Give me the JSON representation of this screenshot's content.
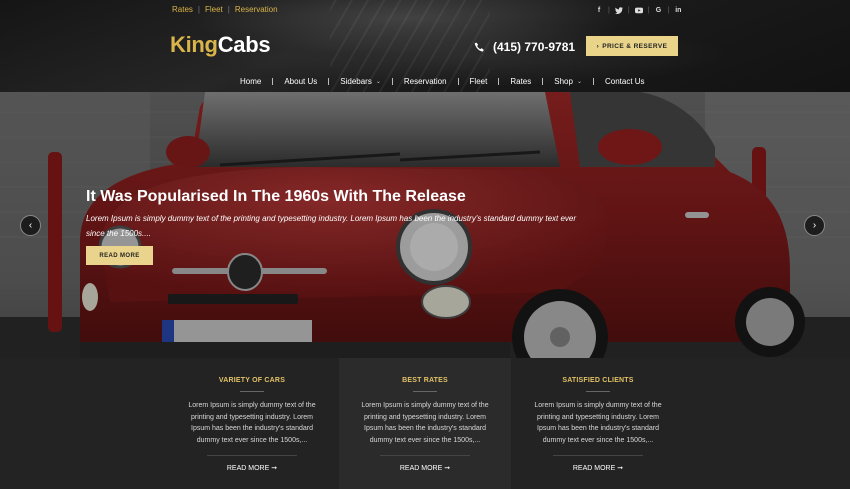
{
  "topbar": {
    "links": [
      "Rates",
      "Fleet",
      "Reservation"
    ],
    "social_icons": [
      "facebook-icon",
      "twitter-icon",
      "youtube-icon",
      "google-icon",
      "linkedin-icon"
    ]
  },
  "header": {
    "logo_part1": "King",
    "logo_part2": "Cabs",
    "phone": "(415) 770-9781",
    "cta_label": "PRICE & RESERVE"
  },
  "nav": {
    "items": [
      {
        "label": "Home",
        "dropdown": false
      },
      {
        "label": "About Us",
        "dropdown": false
      },
      {
        "label": "Sidebars",
        "dropdown": true
      },
      {
        "label": "Reservation",
        "dropdown": false
      },
      {
        "label": "Fleet",
        "dropdown": false
      },
      {
        "label": "Rates",
        "dropdown": false
      },
      {
        "label": "Shop",
        "dropdown": true
      },
      {
        "label": "Contact Us",
        "dropdown": false
      }
    ]
  },
  "hero": {
    "title": "It Was Popularised In The 1960s With The Release",
    "text": "Lorem Ipsum is simply dummy text of the printing and typesetting industry. Lorem Ipsum has been the industry's standard dummy text ever since the 1500s....",
    "button": "READ MORE"
  },
  "features": [
    {
      "title": "VARIETY OF CARS",
      "text": "Lorem Ipsum is simply dummy text of the printing and typesetting industry. Lorem Ipsum has been the industry's standard dummy text ever since the 1500s,...",
      "link": "READ MORE"
    },
    {
      "title": "BEST RATES",
      "text": "Lorem Ipsum is simply dummy text of the printing and typesetting industry. Lorem Ipsum has been the industry's standard dummy text ever since the 1500s,...",
      "link": "READ MORE"
    },
    {
      "title": "SATISFIED CLIENTS",
      "text": "Lorem Ipsum is simply dummy text of the printing and typesetting industry. Lorem Ipsum has been the industry's standard dummy text ever since the 1500s,...",
      "link": "READ MORE"
    }
  ],
  "colors": {
    "accent": "#d9b44a",
    "button": "#e9d48a",
    "car_red": "#8b1d1d"
  }
}
